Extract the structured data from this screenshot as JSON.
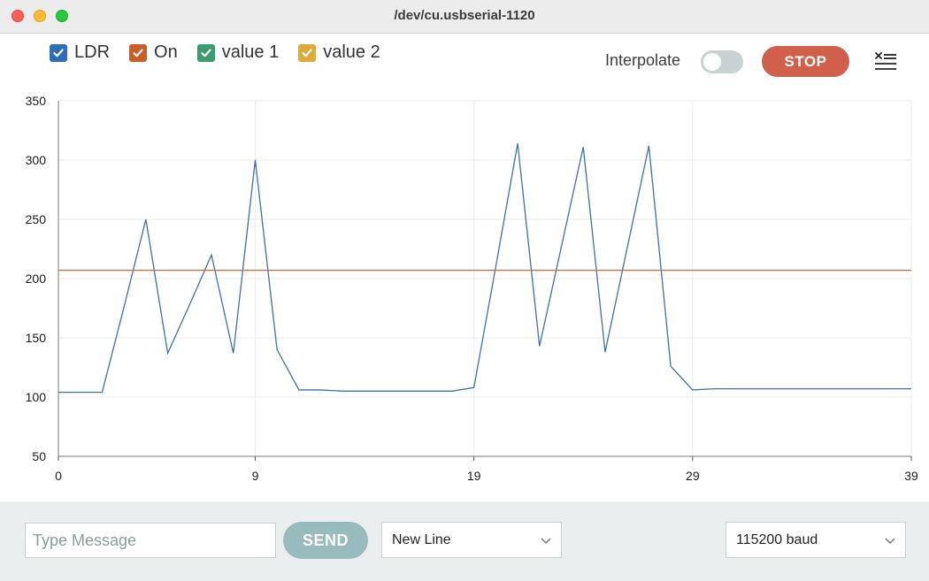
{
  "window": {
    "title": "/dev/cu.usbserial-1120"
  },
  "legend": [
    {
      "label": "LDR",
      "color": "#2f6db5",
      "checked": true
    },
    {
      "label": "On",
      "color": "#c65f29",
      "checked": true
    },
    {
      "label": "value 1",
      "color": "#3c9c6d",
      "checked": true
    },
    {
      "label": "value 2",
      "color": "#e0a93a",
      "checked": true
    }
  ],
  "controls": {
    "interpolate_label": "Interpolate",
    "interpolate_on": false,
    "stop_label": "STOP",
    "clear_icon": "clear-output-icon"
  },
  "chart_data": {
    "type": "line",
    "x_ticks": [
      0,
      9,
      19,
      29,
      39
    ],
    "y_ticks": [
      50,
      100,
      150,
      200,
      250,
      300,
      350
    ],
    "xlim": [
      0,
      39
    ],
    "ylim": [
      50,
      350
    ],
    "grid": true,
    "series": [
      {
        "name": "LDR",
        "color": "#3a72b0",
        "x": [
          0,
          1,
          2,
          3,
          4,
          5,
          6,
          7,
          8,
          9,
          10,
          11,
          12,
          13,
          14,
          15,
          16,
          17,
          18,
          19,
          20,
          21,
          22,
          23,
          24,
          25,
          26,
          27,
          28,
          29,
          30,
          31,
          32,
          33,
          34,
          35,
          36,
          37,
          38,
          39
        ],
        "values": [
          104,
          104,
          104,
          176,
          250,
          137,
          178,
          220,
          137,
          300,
          140,
          106,
          106,
          105,
          105,
          105,
          105,
          105,
          105,
          108,
          210,
          314,
          143,
          227,
          311,
          138,
          225,
          312,
          126,
          106,
          107,
          107,
          107,
          107,
          107,
          107,
          107,
          107,
          107,
          107
        ]
      },
      {
        "name": "On",
        "color": "#c6693a",
        "x": [
          0,
          39
        ],
        "values": [
          207,
          207
        ]
      }
    ]
  },
  "footer": {
    "message_placeholder": "Type Message",
    "send_label": "SEND",
    "line_ending": "New Line",
    "baud": "115200 baud"
  }
}
